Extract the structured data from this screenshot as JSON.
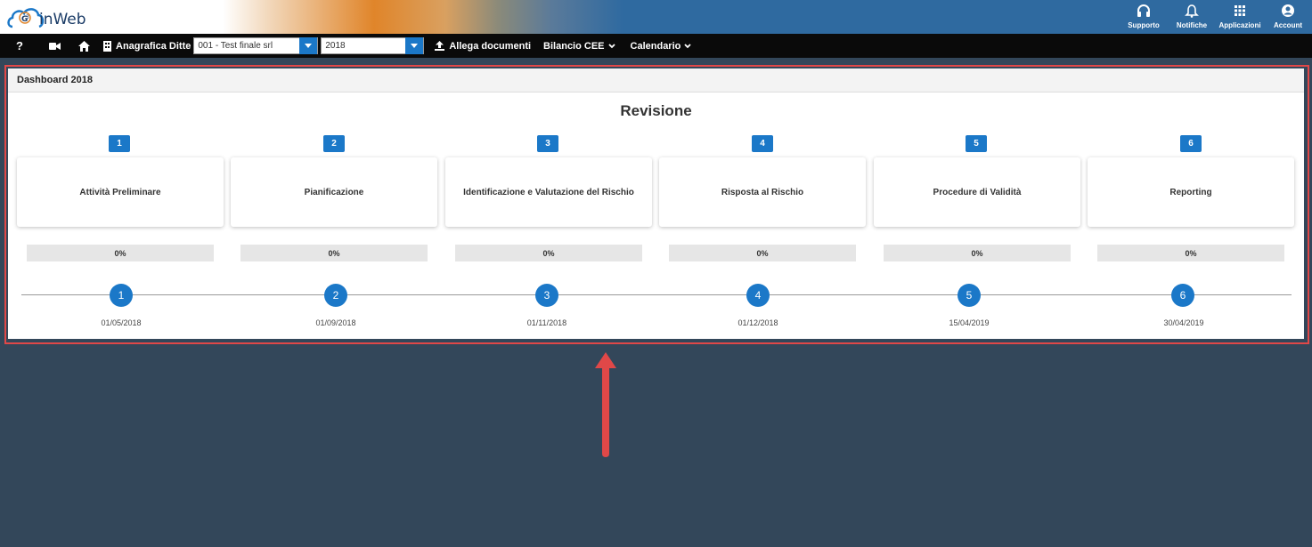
{
  "header": {
    "logo_text": "inWeb",
    "actions": [
      {
        "label": "Supporto",
        "icon": "headset-icon"
      },
      {
        "label": "Notifiche",
        "icon": "bell-icon"
      },
      {
        "label": "Applicazioni",
        "icon": "apps-grid-icon"
      },
      {
        "label": "Account",
        "icon": "account-icon"
      }
    ]
  },
  "toolbar": {
    "help": "?",
    "company_label": "Anagrafica Ditte",
    "company_value": "001 - Test finale srl",
    "year_value": "2018",
    "attach_label": "Allega documenti",
    "bilancio_label": "Bilancio CEE",
    "calendario_label": "Calendario"
  },
  "panel": {
    "header": "Dashboard 2018",
    "title": "Revisione",
    "phases": [
      {
        "num": "1",
        "label": "Attività Preliminare",
        "progress": "0%",
        "date": "01/05/2018"
      },
      {
        "num": "2",
        "label": "Pianificazione",
        "progress": "0%",
        "date": "01/09/2018"
      },
      {
        "num": "3",
        "label": "Identificazione e Valutazione del Rischio",
        "progress": "0%",
        "date": "01/11/2018"
      },
      {
        "num": "4",
        "label": "Risposta al Rischio",
        "progress": "0%",
        "date": "01/12/2018"
      },
      {
        "num": "5",
        "label": "Procedure di Validità",
        "progress": "0%",
        "date": "15/04/2019"
      },
      {
        "num": "6",
        "label": "Reporting",
        "progress": "0%",
        "date": "30/04/2019"
      }
    ]
  },
  "colors": {
    "accent": "#1b78c8",
    "background": "#33475a",
    "annotation": "#e04848"
  }
}
